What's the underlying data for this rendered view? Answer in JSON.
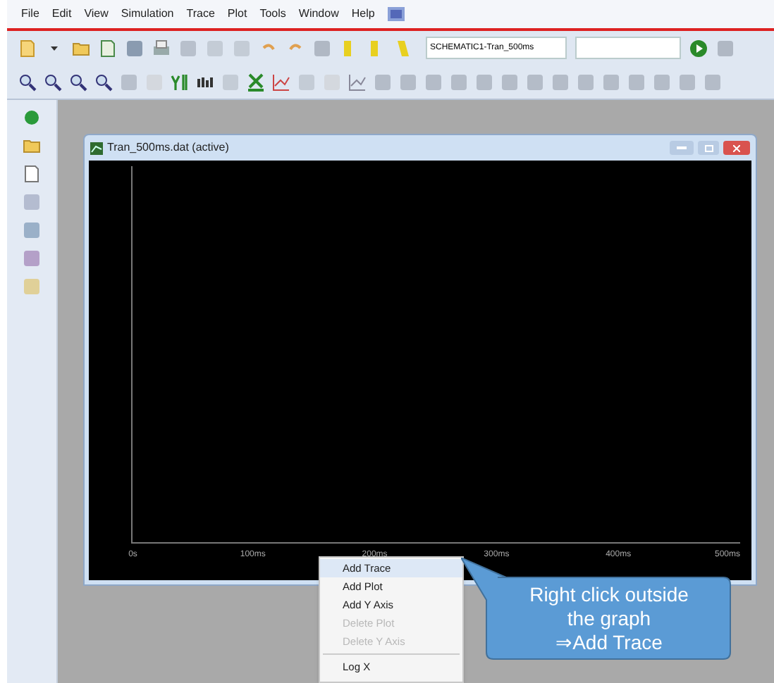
{
  "menu_bar": [
    "File",
    "Edit",
    "View",
    "Simulation",
    "Trace",
    "Plot",
    "Tools",
    "Window",
    "Help"
  ],
  "toolbar": {
    "profile_field": "SCHEMATIC1-Tran_500ms"
  },
  "plot_window": {
    "title": "Tran_500ms.dat (active)",
    "x_axis_labels": [
      "0s",
      "100ms",
      "200ms",
      "300ms",
      "400ms",
      "500ms"
    ]
  },
  "context_menu": [
    {
      "label": "Add Trace",
      "selected": true,
      "disabled": false
    },
    {
      "label": "Add Plot",
      "selected": false,
      "disabled": false
    },
    {
      "label": "Add Y Axis",
      "selected": false,
      "disabled": false
    },
    {
      "label": "Delete Plot",
      "selected": false,
      "disabled": true
    },
    {
      "label": "Delete Y Axis",
      "selected": false,
      "disabled": true
    },
    {
      "label": "Log X",
      "selected": false,
      "disabled": false,
      "separator_before": true
    }
  ],
  "callout": [
    "Right click outside",
    "the graph",
    "⇒Add Trace"
  ]
}
